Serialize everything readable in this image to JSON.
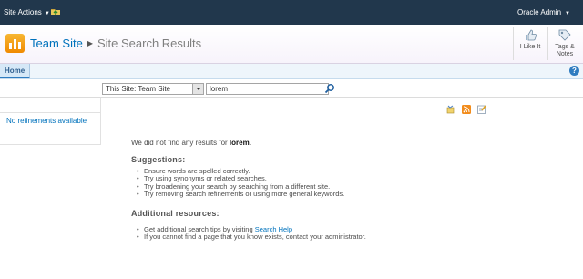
{
  "topbar": {
    "site_actions_label": "Site Actions",
    "user_label": "Oracle Admin"
  },
  "header": {
    "site_title": "Team Site",
    "page_title": "Site Search Results",
    "ribbon": [
      {
        "label_line1": "I Like It",
        "label_line2": "",
        "icon": "thumbs-up-icon"
      },
      {
        "label_line1": "Tags &",
        "label_line2": "Notes",
        "icon": "tag-icon"
      }
    ]
  },
  "tabs": {
    "home_label": "Home",
    "help_glyph": "?"
  },
  "search": {
    "scope_value": "This Site: Team Site",
    "query_value": "lorem"
  },
  "refinements": {
    "text": "No refinements available"
  },
  "results": {
    "no_results_prefix": "We did not find any results for ",
    "query_term": "lorem",
    "no_results_suffix": ".",
    "suggestions_heading": "Suggestions:",
    "suggestions": [
      "Ensure words are spelled correctly.",
      "Try using synonyms or related searches.",
      "Try broadening your search by searching from a different site.",
      "Try removing search refinements or using more general keywords."
    ],
    "resources_heading": "Additional resources:",
    "resource_tip_prefix": "Get additional search tips by visiting ",
    "resource_tip_link": "Search Help",
    "resource_contact": "If you cannot find a page that you know exists, contact your administrator."
  },
  "colors": {
    "topbar": "#21374c",
    "link": "#0072bc",
    "tab_accent": "#2f7cc0"
  }
}
